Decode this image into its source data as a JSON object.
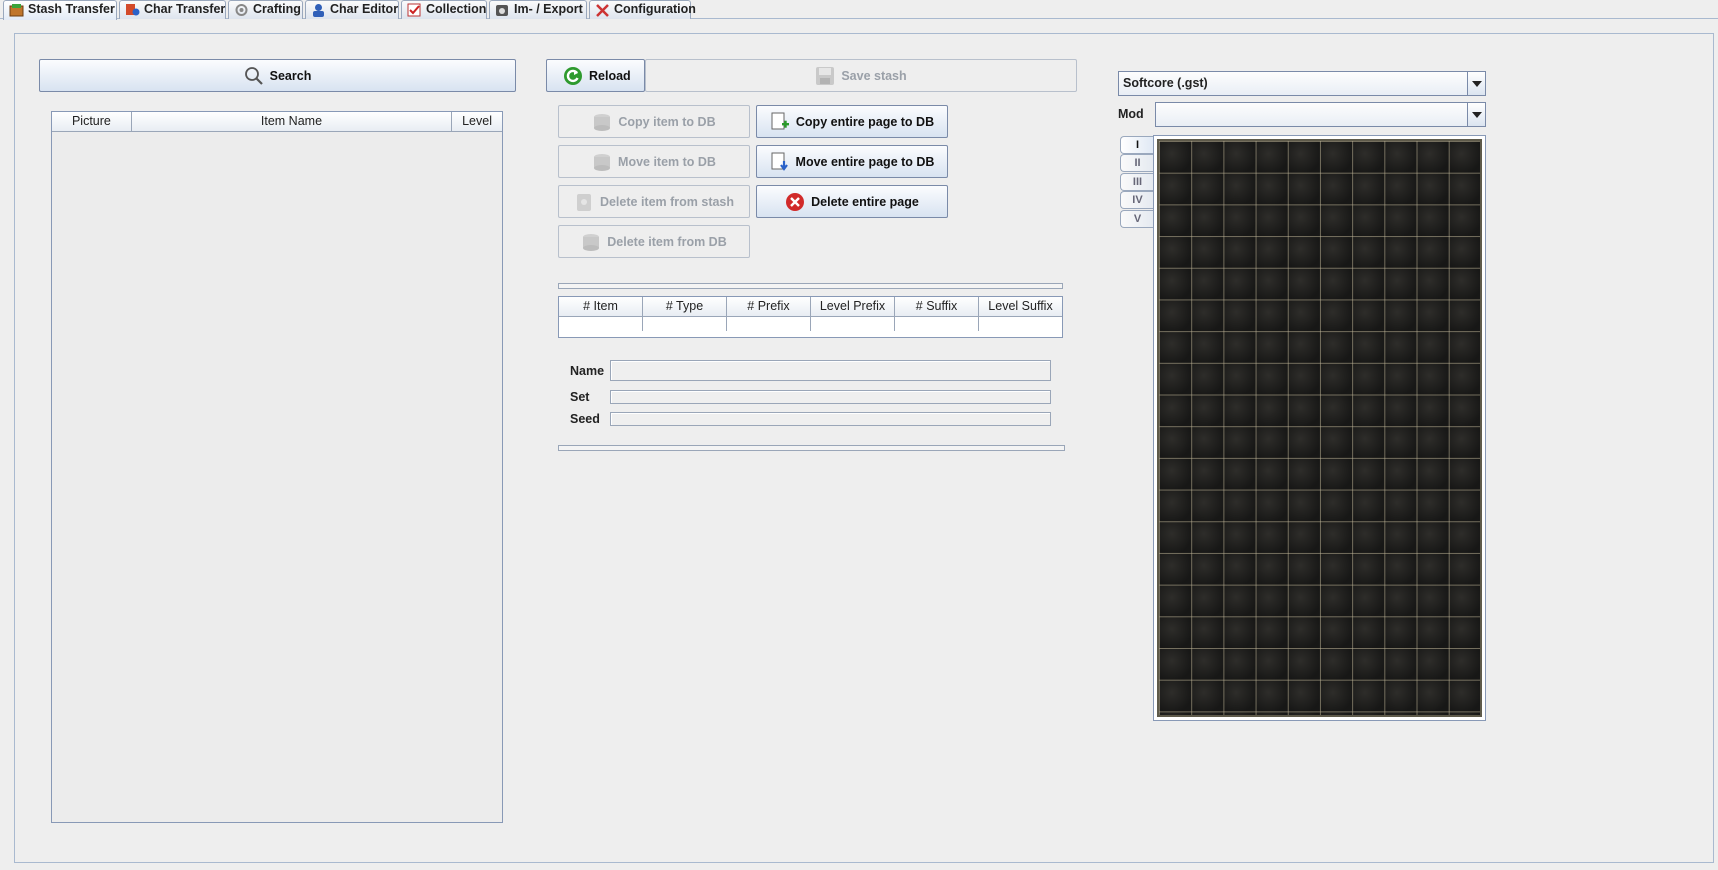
{
  "tabs": [
    {
      "label": "Stash Transfer",
      "icon": "stash-transfer-icon"
    },
    {
      "label": "Char Transfer",
      "icon": "char-transfer-icon"
    },
    {
      "label": "Crafting",
      "icon": "crafting-gear-icon"
    },
    {
      "label": "Char Editor",
      "icon": "char-editor-icon"
    },
    {
      "label": "Collection",
      "icon": "collection-icon"
    },
    {
      "label": "Im- / Export",
      "icon": "import-export-icon"
    },
    {
      "label": "Configuration",
      "icon": "configuration-tools-icon"
    }
  ],
  "search": {
    "label": "Search"
  },
  "item_list": {
    "columns": [
      "Picture",
      "Item Name",
      "Level"
    ],
    "rows": []
  },
  "actions": {
    "reload": "Reload",
    "save_stash": "Save stash",
    "copy_item_to_db": "Copy item to DB",
    "copy_entire_page_to_db": "Copy entire page to DB",
    "move_item_to_db": "Move item to DB",
    "move_entire_page_to_db": "Move entire page to DB",
    "delete_item_from_stash": "Delete item from stash",
    "delete_entire_page": "Delete entire page",
    "delete_item_from_db": "Delete item from DB"
  },
  "item_props": {
    "columns": [
      "# Item",
      "# Type",
      "# Prefix",
      "Level Prefix",
      "# Suffix",
      "Level Suffix"
    ],
    "rows": []
  },
  "details": {
    "name_label": "Name",
    "set_label": "Set",
    "seed_label": "Seed",
    "name": "",
    "set": "",
    "seed": ""
  },
  "stash_select": {
    "value": "Softcore (.gst)"
  },
  "mod": {
    "label": "Mod",
    "value": ""
  },
  "stash_pages": {
    "tabs": [
      "I",
      "II",
      "III",
      "IV",
      "V"
    ],
    "active": "I"
  },
  "colors": {
    "accent_border": "#7a8aa8",
    "stash_bg": "#1c1c1a",
    "stash_grid_line": "#beb496"
  }
}
